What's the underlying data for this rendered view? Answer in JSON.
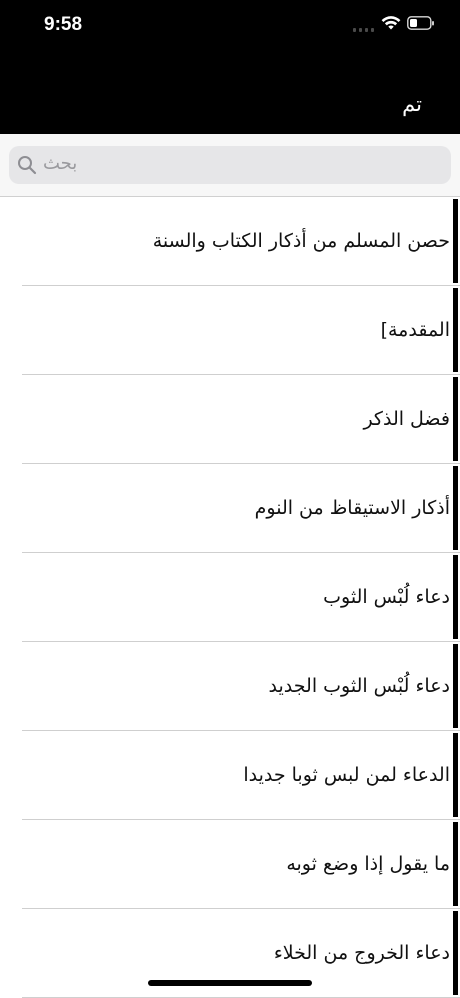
{
  "status_bar": {
    "time": "9:58"
  },
  "nav": {
    "done_label": "تم"
  },
  "search": {
    "placeholder": "بحث"
  },
  "list": {
    "items": [
      {
        "label": "حصن المسلم من أذكار الكتاب والسنة"
      },
      {
        "label": "المقدمة]"
      },
      {
        "label": "فضل الذكر"
      },
      {
        "label": "أذكار الاستيقاظ من النوم"
      },
      {
        "label": "دعاء لُبْس الثوب"
      },
      {
        "label": "دعاء لُبْس الثوب الجديد"
      },
      {
        "label": "الدعاء لمن لبس ثوبا جديدا"
      },
      {
        "label": "ما يقول إذا وضع ثوبه"
      },
      {
        "label": "دعاء الخروج من الخلاء"
      }
    ]
  },
  "icons": {
    "search": "search-icon",
    "wifi": "wifi-icon",
    "battery": "battery-icon",
    "signal": "cellular-signal-icon"
  },
  "colors": {
    "header_bg": "#000000",
    "search_bg": "#e6e6e8",
    "accent_bar": "#000000"
  }
}
